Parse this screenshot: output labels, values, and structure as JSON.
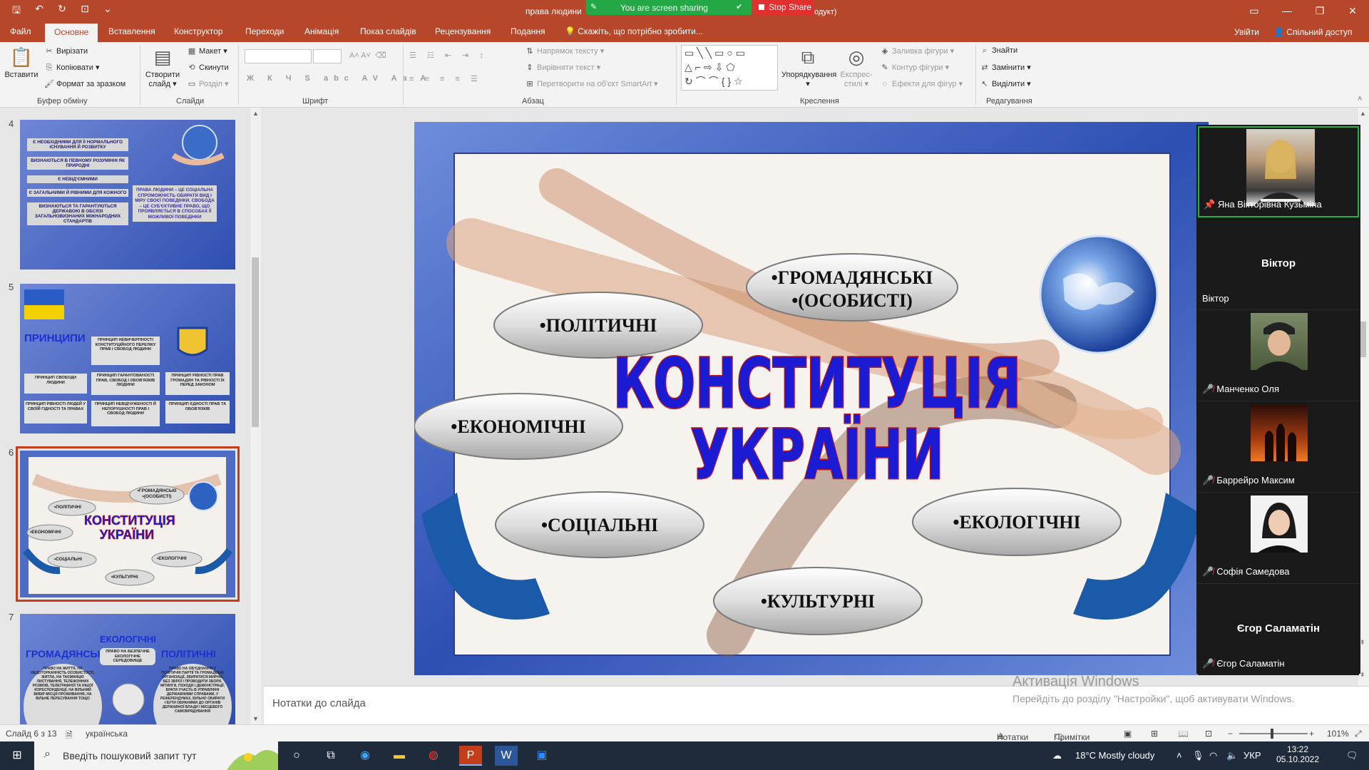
{
  "titlebar": {
    "doc_title": "права людини",
    "doc_title_tail": "одукт)",
    "share_status": "You are screen sharing",
    "stop_share_label": "Stop Share"
  },
  "ribbon_tabs": {
    "items": [
      "Файл",
      "Основне",
      "Вставлення",
      "Конструктор",
      "Переходи",
      "Анімація",
      "Показ слайдів",
      "Рецензування",
      "Подання"
    ],
    "search": "Скажіть, що потрібно зробити...",
    "signin": "Увійти",
    "share": "Спільний доступ"
  },
  "ribbon": {
    "clipboard": {
      "paste": "Вставити",
      "cut": "Вирізати",
      "copy": "Копіювати",
      "format_painter": "Формат за зразком",
      "label": "Буфер обміну"
    },
    "slides": {
      "new_slide_1": "Створити",
      "new_slide_2": "слайд",
      "layout": "Макет",
      "reset": "Скинути",
      "section": "Розділ",
      "label": "Слайди"
    },
    "font": {
      "label": "Шрифт"
    },
    "paragraph": {
      "text_direction": "Напрямок тексту",
      "align_text": "Вирівняти текст",
      "smartart": "Перетворити на об'єкт SmartArt",
      "label": "Абзац"
    },
    "drawing": {
      "arrange": "Упорядкування",
      "quick_styles_1": "Експрес-",
      "quick_styles_2": "стилі",
      "shape_fill": "Заливка фігури",
      "shape_outline": "Контур фігури",
      "shape_effects": "Ефекти для фігур",
      "label": "Креслення"
    },
    "editing": {
      "find": "Знайти",
      "replace": "Замінити",
      "select": "Виділити",
      "label": "Редагування"
    }
  },
  "thumbnails": {
    "numbers": [
      "4",
      "5",
      "6",
      "7"
    ],
    "slide4": {
      "left_boxes": [
        "Є НЕОБХІДНИМИ ДЛЯ Її НОРМАЛЬНОГО ІСНУВАННЯ Й РОЗВИТКУ",
        "ВИЗНАЮТЬСЯ В ПЕВНОМУ РОЗУМІННІ ЯК ПРИРОДНІ",
        "Є НЕВІД'ЄМНИМИ",
        "Є ЗАГАЛЬНИМИ Й РІВНИМИ ДЛЯ КОЖНОГО",
        "ВИЗНАЮТЬСЯ ТА ГАРАНТУЮТЬСЯ ДЕРЖАВОЮ В ОБСЯЗІ ЗАГАЛЬНОВИЗНАНИХ МІЖНАРОДНИХ СТАНДАРТІВ"
      ],
      "right_box": "ПРАВА ЛЮДИНИ – ЦЕ СОЦІАЛЬНА СПРОМОЖНІСТЬ ОБИРАТИ ВИД І МІРУ СВОЄЇ ПОВЕДІНКИ. СВОБОДА – ЦЕ СУБ'ЄКТИВНЕ ПРАВО, ЩО ПРОЯВЛЯЄТЬСЯ В СПОСОБАХ ЇЇ МОЖЛИВОЇ ПОВЕДІНКИ"
    },
    "slide5": {
      "title": "ПРИНЦИПИ",
      "boxes": [
        "ПРИНЦИП НЕВИЧЕРПНОСТІ КОНСТИТУЦІЙНОГО ПЕРЕЛІКУ ПРАВ І СВОБОД ЛЮДИНИ",
        "ПРИНЦИП СВОБОДИ ЛЮДИНИ",
        "ПРИНЦИП ГАРАНТОВАНОСТІ ПРАВ, СВОБОД І ОБОВ'ЯЗКІВ ЛЮДИНИ",
        "ПРИНЦИП РІВНОСТІ ПРАВ ГРОМАДЯН ТА РІВНОСТІ ЇХ ПЕРЕД ЗАКОНОМ",
        "ПРИНЦИП РІВНОСТІ ЛЮДЕЙ У СВОЇЙ ГІДНОСТІ ТА ПРАВАХ",
        "ПРИНЦИП НЕВІДЧУЖЕНОСТІ Й НЕПОРУШНОСТІ ПРАВ І СВОБОД ЛЮДИНИ",
        "ПРИНЦИП ЄДНОСТІ ПРАВ ТА ОБОВ'ЯЗКІВ"
      ]
    },
    "slide7": {
      "headings": [
        "ЕКОЛОГІЧНІ",
        "ГРОМАДЯНСЬКІ",
        "ПОЛІТИЧНІ"
      ],
      "center_box": "ПРАВО НА БЕЗПЕЧНЕ ЕКОЛОГІЧНЕ СЕРЕДОВИЩЕ",
      "left_text": "ПРАВО НА ЖИТТЯ, НА НЕДОТОРКАННІСТЬ ОСОБИСТОСТІ, ЖИТЛА, НА ТАЄМНИЦЮ ЛИСТУВАННЯ, ТЕЛЕФОННИХ РОЗМОВ, ТЕЛЕГРАФНОЇ ТА ІНШОЇ КОРЕСПОНДЕНЦІЇ, НА ВІЛЬНИЙ ВИБІР МІСЦЯ ПРОЖИВАННЯ, НА ВІЛЬНЕ ПЕРЕСУВАННЯ ТОЩО",
      "right_text": "ПРАВО НА ОБ'ЄДНАННЯ У ПОЛІТИЧНІ ПАРТІЇ ТА ГРОМАДСЬКІ ОРГАНІЗАЦІЇ, ЗБИРАТИСЯ МИРНО, БЕЗ ЗБРОЇ І ПРОВОДИТИ ЗБОРИ, МІТИНГИ, ПОХОДИ І ДЕМОНСТРАЦІЇ, БРАТИ УЧАСТЬ В УПРАВЛІННІ ДЕРЖАВНИМИ СПРАВАМИ, У РЕФЕРЕНДУМАХ, ВІЛЬНО ОБИРАТИ І БУТИ ОБРАНИМИ ДО ОРГАНІВ ДЕРЖАВНОЇ ВЛАДИ І МІСЦЕВОГО САМОВРЯДУВАННЯ"
    }
  },
  "slide": {
    "title_line1": "КОНСТИТУЦІЯ",
    "title_line2": "УКРАЇНИ",
    "ellipses": {
      "civil_1": "•ГРОМАДЯНСЬКІ",
      "civil_2": "•(ОСОБИСТІ)",
      "political": "•ПОЛІТИЧНІ",
      "economic": "•ЕКОНОМІЧНІ",
      "social": "•СОЦІАЛЬНІ",
      "ecological": "•ЕКОЛОГІЧНІ",
      "cultural": "•КУЛЬТУРНІ"
    },
    "colors": {
      "title_fill": "#1b1bd4",
      "title_stroke": "#c01818",
      "frame": "#3f5fc0"
    }
  },
  "notes": {
    "placeholder": "Нотатки до слайда"
  },
  "activation": {
    "line1": "Активація Windows",
    "line2": "Перейдіть до розділу \"Настройки\", щоб активувати Windows."
  },
  "participants": [
    {
      "name": "Яна Вікторівна Кузьміна",
      "big": "",
      "photo": true,
      "muted": false,
      "pinned": true
    },
    {
      "name": "Віктор",
      "big": "Віктор",
      "photo": false,
      "muted": false,
      "pinned": false
    },
    {
      "name": "Манченко Оля",
      "big": "",
      "photo": true,
      "muted": true,
      "pinned": false
    },
    {
      "name": "Баррейро Максим",
      "big": "",
      "photo": true,
      "muted": true,
      "pinned": false
    },
    {
      "name": "Софія Самедова",
      "big": "",
      "photo": true,
      "muted": true,
      "pinned": false
    },
    {
      "name": "Єгор Саламатін",
      "big": "Єгор Саламатін",
      "photo": false,
      "muted": true,
      "pinned": false
    }
  ],
  "statusbar": {
    "slide_counter": "Слайд 6 з 13",
    "language": "українська",
    "notes": "Нотатки",
    "comments": "Примітки",
    "zoom": "101%"
  },
  "taskbar": {
    "search_placeholder": "Введіть пошуковий запит тут",
    "weather": "18°C  Mostly cloudy",
    "lang": "УКР",
    "time": "13:22",
    "date": "05.10.2022"
  }
}
